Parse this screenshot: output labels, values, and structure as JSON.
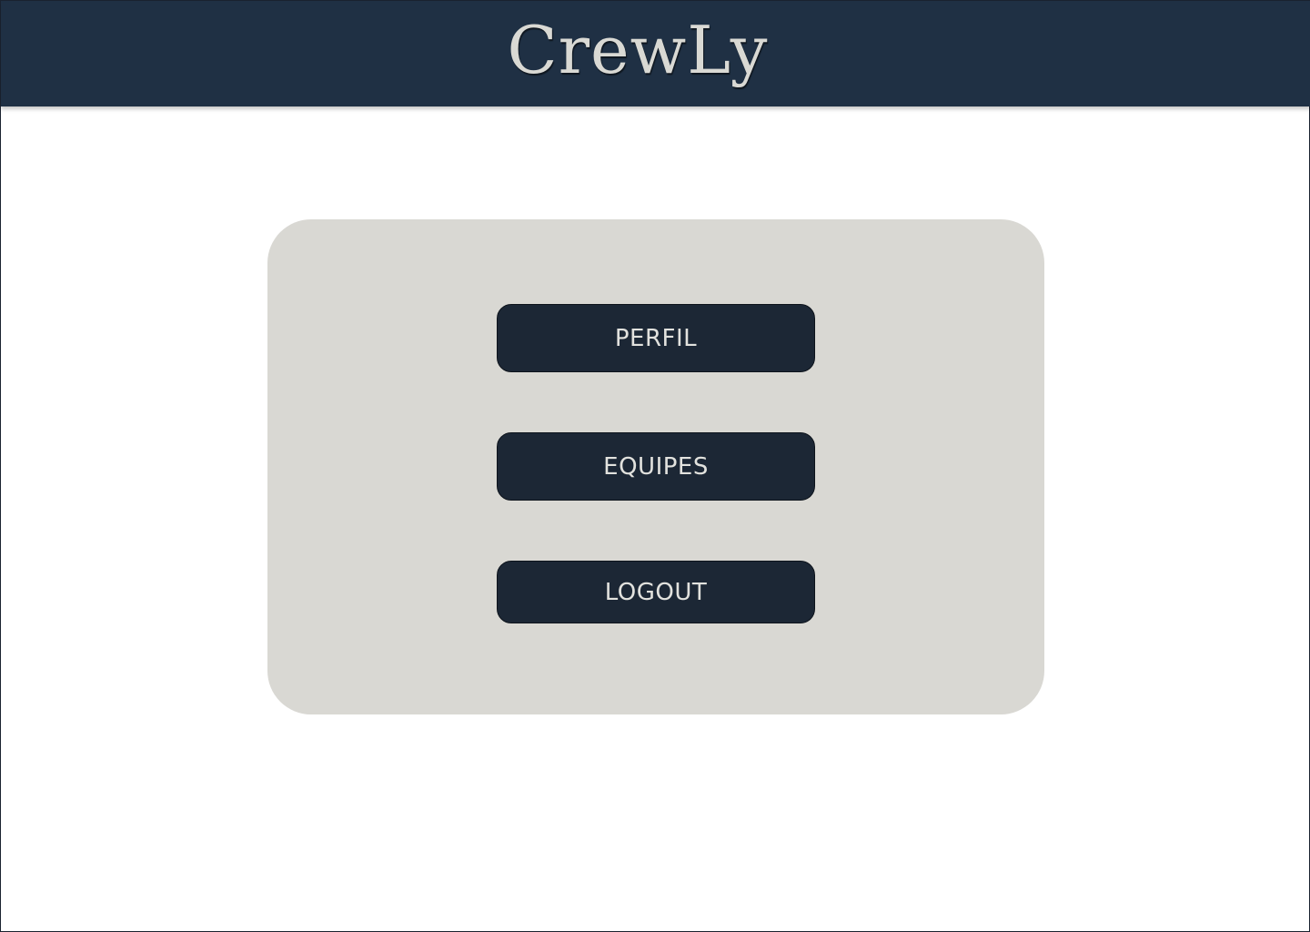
{
  "app": {
    "title": "CrewLy"
  },
  "menu": {
    "items": [
      {
        "label": "PERFIL"
      },
      {
        "label": "EQUIPES"
      },
      {
        "label": "LOGOUT"
      }
    ]
  },
  "colors": {
    "header_bg": "#1f3044",
    "logo_text": "#d9d9d4",
    "card_bg": "#d9d8d3",
    "button_bg": "#1c2735",
    "button_text": "#e2e2de"
  }
}
